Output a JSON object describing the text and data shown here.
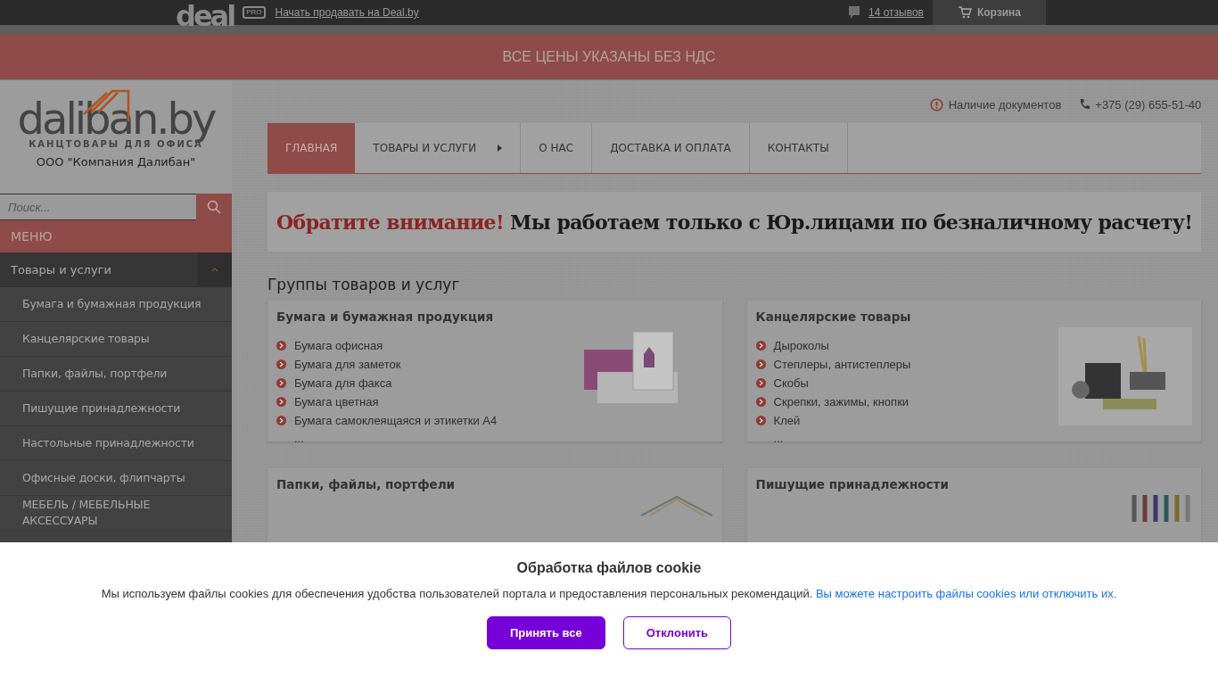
{
  "topbar": {
    "logo": "deal",
    "pro_badge": "PRO",
    "sell_link": "Начать продавать на Deal.by",
    "reviews": "14 отзывов",
    "cart": "Корзина"
  },
  "notice_banner": "ВСЕ ЦЕНЫ УКАЗАНЫ БЕЗ НДС",
  "sidebar": {
    "logo": "daliban.by",
    "logo_tagline": "КАНЦТОВАРЫ ДЛЯ ОФИСА",
    "company": "ООО \"Компания Далибан\"",
    "search": {
      "placeholder": "Поиск..."
    },
    "menu_title": "МЕНЮ",
    "items": [
      {
        "label": "Товары и услуги",
        "expanded": true,
        "children": [
          {
            "label": "Бумага и бумажная продукция"
          },
          {
            "label": "Канцелярские товары"
          },
          {
            "label": "Папки, файлы, портфели"
          },
          {
            "label": "Пишущие принадлежности"
          },
          {
            "label": "Настольные принадлежности"
          },
          {
            "label": "Офисные доски, флипчарты"
          },
          {
            "label": "МЕБЕЛЬ / МЕБЕЛЬНЫЕ АКСЕССУАРЫ"
          }
        ]
      }
    ]
  },
  "header_links": {
    "documents": "Наличие документов",
    "phone": "+375 (29) 655-51-40"
  },
  "nav": [
    {
      "label": "ГЛАВНАЯ",
      "selected": true,
      "submenu": false
    },
    {
      "label": "ТОВАРЫ И УСЛУГИ",
      "selected": false,
      "submenu": true
    },
    {
      "label": "О НАС",
      "selected": false,
      "submenu": false
    },
    {
      "label": "ДОСТАВКА И ОПЛАТА",
      "selected": false,
      "submenu": false
    },
    {
      "label": "КОНТАКТЫ",
      "selected": false,
      "submenu": false
    }
  ],
  "attention": {
    "lead": "Обратите внимание!",
    "text": "Мы работаем только с Юр.лицами по безналичному расчету!"
  },
  "groups_title": "Группы товаров и услуг",
  "groups": [
    {
      "title": "Бумага и бумажная продукция",
      "items": [
        "Бумага офисная",
        "Бумага для заметок",
        "Бумага для факса",
        "Бумага цветная",
        "Бумага самоклеящаяся и этикетки А4"
      ],
      "more": "..."
    },
    {
      "title": "Канцелярские товары",
      "items": [
        "Дыроколы",
        "Степлеры, антистеплеры",
        "Скобы",
        "Скрепки, зажимы, кнопки",
        "Клей"
      ],
      "more": "..."
    },
    {
      "title": "Папки, файлы, портфели"
    },
    {
      "title": "Пишущие принадлежности"
    }
  ],
  "cookie": {
    "title": "Обработка файлов cookie",
    "text": "Мы используем файлы cookies для обеспечения удобства пользователей портала и предоставления персональных рекомендаций.",
    "link": "Вы можете настроить файлы cookies или отключить их.",
    "accept": "Принять все",
    "decline": "Отклонить"
  }
}
